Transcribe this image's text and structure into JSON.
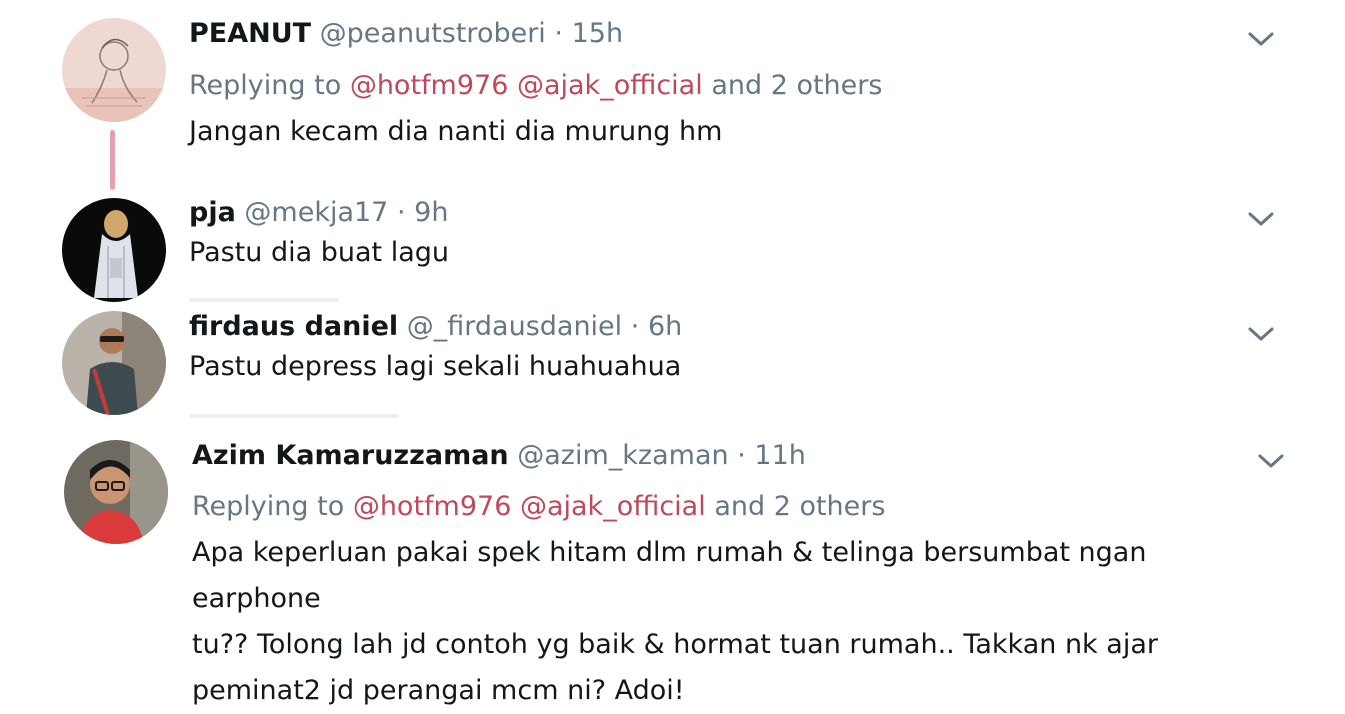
{
  "tweets": [
    {
      "name": "PEANUT",
      "handle": "@peanutstroberi",
      "separator": "·",
      "time": "15h",
      "replying_prefix": "Replying to",
      "replying_mentions": [
        "@hotfm976",
        "@ajak_official"
      ],
      "replying_suffix": "and 2 others",
      "text": "Jangan kecam dia nanti dia murung hm",
      "avatar_icon": "avatar-sketch-illustration"
    },
    {
      "name": "pja",
      "handle": "@mekja17",
      "separator": "·",
      "time": "9h",
      "text": "Pastu dia buat lagu",
      "avatar_icon": "avatar-hijab-figure"
    },
    {
      "name": "firdaus daniel",
      "handle": "@_firdausdaniel",
      "separator": "·",
      "time": "6h",
      "text": "Pastu depress lagi sekali huahuahua",
      "avatar_icon": "avatar-man-sunglasses"
    },
    {
      "name": "Azim Kamaruzzaman",
      "handle": "@azim_kzaman",
      "separator": "·",
      "time": "11h",
      "replying_prefix": "Replying to",
      "replying_mentions": [
        "@hotfm976",
        "@ajak_official"
      ],
      "replying_suffix": "and 2 others",
      "text_lines": [
        "Apa keperluan pakai spek hitam dlm rumah & telinga bersumbat ngan earphone",
        "tu?? Tolong lah jd contoh yg baik & hormat tuan rumah.. Takkan nk ajar",
        "peminat2 jd perangai mcm ni? Adoi!"
      ],
      "avatar_icon": "avatar-man-glasses"
    }
  ],
  "colors": {
    "mention": "#c0485b",
    "secondary_text": "#657786",
    "primary_text": "#14171a",
    "thread_line": "#e6a1ad"
  },
  "icons": {
    "more_menu": "chevron-down-icon"
  }
}
